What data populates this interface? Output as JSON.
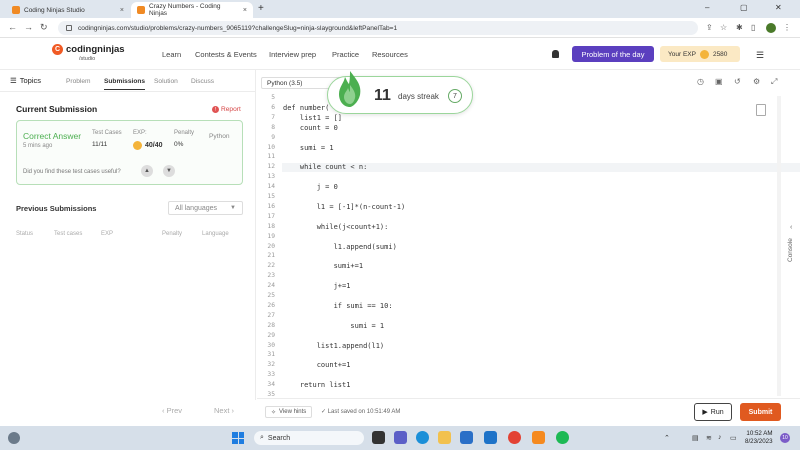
{
  "browser": {
    "tabs": [
      {
        "title": "Coding Ninjas Studio",
        "close": "×"
      },
      {
        "title": "Crazy Numbers - Coding Ninjas",
        "close": "×"
      }
    ],
    "new_tab": "+",
    "window_controls": [
      "–",
      "▢",
      "✕"
    ],
    "nav": [
      "←",
      "→",
      "↻"
    ],
    "url": "codingninjas.com/studio/problems/crazy-numbers_9065119?challengeSlug=ninja-slayground&leftPanelTab=1",
    "profile_initial": "I"
  },
  "site": {
    "logo_name": "codingninjas",
    "logo_sub": "/studio",
    "nav": [
      "Learn",
      "Contests & Events",
      "Interview prep",
      "Practice",
      "Resources"
    ],
    "problem_of_day": "Problem of the day",
    "your_exp_label": "Your EXP",
    "your_exp_value": "2580"
  },
  "left": {
    "topics": "Topics",
    "tabs": [
      "Problem",
      "Submissions",
      "Solution",
      "Discuss"
    ],
    "current_title": "Current Submission",
    "report": "Report",
    "card": {
      "status": "Correct Answer",
      "time": "5 mins ago",
      "test_cases_label": "Test Cases",
      "test_cases_value": "11/11",
      "exp_label": "EXP:",
      "exp_value": "40/40",
      "penalty_label": "Penalty",
      "penalty_value": "0%",
      "language": "Python",
      "useful_q": "Did you find these test cases useful?"
    },
    "previous_title": "Previous Submissions",
    "language_filter": "All languages",
    "table_headers": [
      "Status",
      "Test cases",
      "EXP",
      "Penalty",
      "Language"
    ],
    "prev": "‹ Prev",
    "next": "Next ›"
  },
  "editor": {
    "language": "Python (3.5)",
    "line_numbers": [
      "5",
      "6",
      "7",
      "8",
      "9",
      "10",
      "11",
      "12",
      "13",
      "14",
      "15",
      "16",
      "17",
      "18",
      "19",
      "20",
      "21",
      "22",
      "23",
      "24",
      "25",
      "26",
      "27",
      "28",
      "29",
      "30",
      "31",
      "32",
      "33",
      "34",
      "35"
    ],
    "code_lines": [
      "",
      "def number(",
      "    list1 = []",
      "    count = 0",
      "",
      "    sumi = 1",
      "",
      "    while count < n:",
      "",
      "        j = 0",
      "",
      "        l1 = [-1]*(n-count-1)",
      "",
      "        while(j<count+1):",
      "",
      "            l1.append(sumi)",
      "",
      "            sumi+=1",
      "",
      "            j+=1",
      "",
      "            if sumi == 10:",
      "",
      "                sumi = 1",
      "",
      "        list1.append(l1)",
      "",
      "        count+=1",
      "",
      "    return list1",
      ""
    ],
    "streak_days": "11",
    "streak_label": "days streak",
    "streak_badge": "7",
    "console": "Console",
    "view_hints": "View hints",
    "last_saved": "Last saved on 10:51:49 AM",
    "run": "Run",
    "submit": "Submit"
  },
  "taskbar": {
    "search": "Search",
    "time": "10:52 AM",
    "date": "8/23/2023",
    "notif": "10"
  },
  "colors": {
    "accent_purple": "#5b3fbf",
    "submit_orange": "#e05a20",
    "success_green": "#4caf50"
  }
}
